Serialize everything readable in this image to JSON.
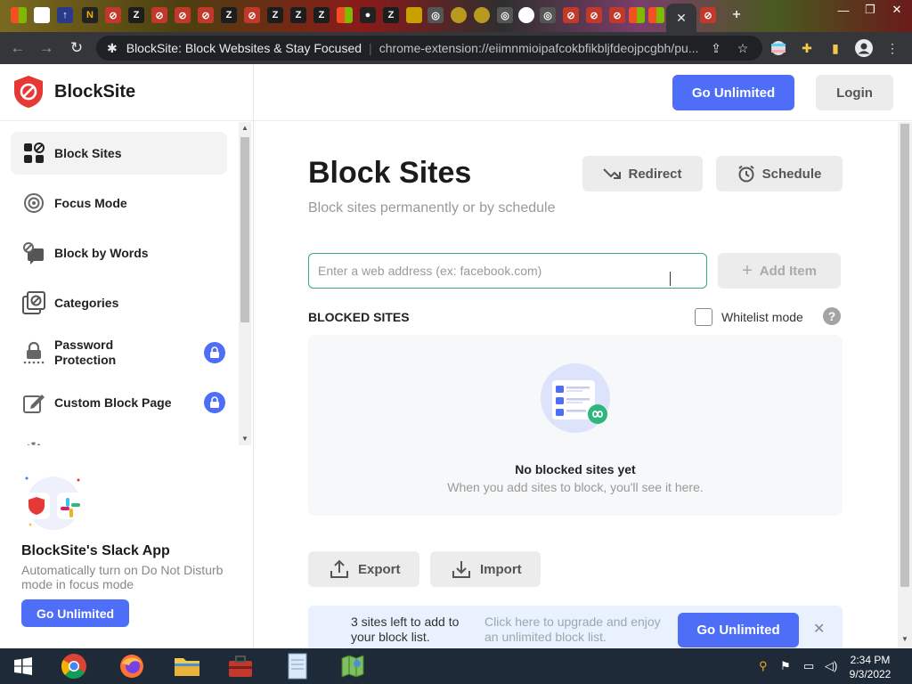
{
  "browser": {
    "page_title": "BlockSite: Block Websites & Stay Focused",
    "url": "chrome-extension://eiimnmioipafcokbfikbljfdeojpcgbh/pu...",
    "close_tab_glyph": "✕"
  },
  "header": {
    "brand": "BlockSite",
    "go_unlimited": "Go Unlimited",
    "login": "Login"
  },
  "sidebar": {
    "items": [
      {
        "label": "Block Sites",
        "active": true
      },
      {
        "label": "Focus Mode"
      },
      {
        "label": "Block by Words"
      },
      {
        "label": "Categories"
      },
      {
        "label": "Password Protection",
        "locked": true
      },
      {
        "label": "Custom Block Page",
        "locked": true
      }
    ]
  },
  "promo": {
    "title": "BlockSite's Slack App",
    "text": "Automatically turn on Do Not Disturb mode in focus mode",
    "button": "Go Unlimited"
  },
  "main": {
    "title": "Block Sites",
    "subtitle": "Block sites permanently or by schedule",
    "redirect": "Redirect",
    "schedule": "Schedule",
    "input_placeholder": "Enter a web address (ex: facebook.com)",
    "add_item": "Add Item",
    "blocked_sites_label": "BLOCKED SITES",
    "whitelist_mode": "Whitelist mode",
    "help_glyph": "?",
    "empty_title": "No blocked sites yet",
    "empty_subtitle": "When you add sites to block, you'll see it here.",
    "export": "Export",
    "import": "Import"
  },
  "upgrade_bar": {
    "left_text": "3 sites left to add to your block list.",
    "mid_text": "Click here to upgrade and enjoy an unlimited block list.",
    "button": "Go Unlimited",
    "close_glyph": "✕"
  },
  "taskbar": {
    "time": "2:34 PM",
    "date": "9/3/2022"
  },
  "colors": {
    "accent": "#4f6ef7",
    "brand_red": "#e53935",
    "input_border": "#3aa776"
  },
  "icons": [
    "blocksite-logo-icon",
    "block-sites-icon",
    "focus-mode-icon",
    "block-by-words-icon",
    "categories-icon",
    "password-lock-icon",
    "custom-page-icon",
    "lock-icon",
    "redirect-icon",
    "alarm-clock-icon",
    "plus-icon",
    "help-icon",
    "export-icon",
    "import-icon",
    "close-icon"
  ]
}
